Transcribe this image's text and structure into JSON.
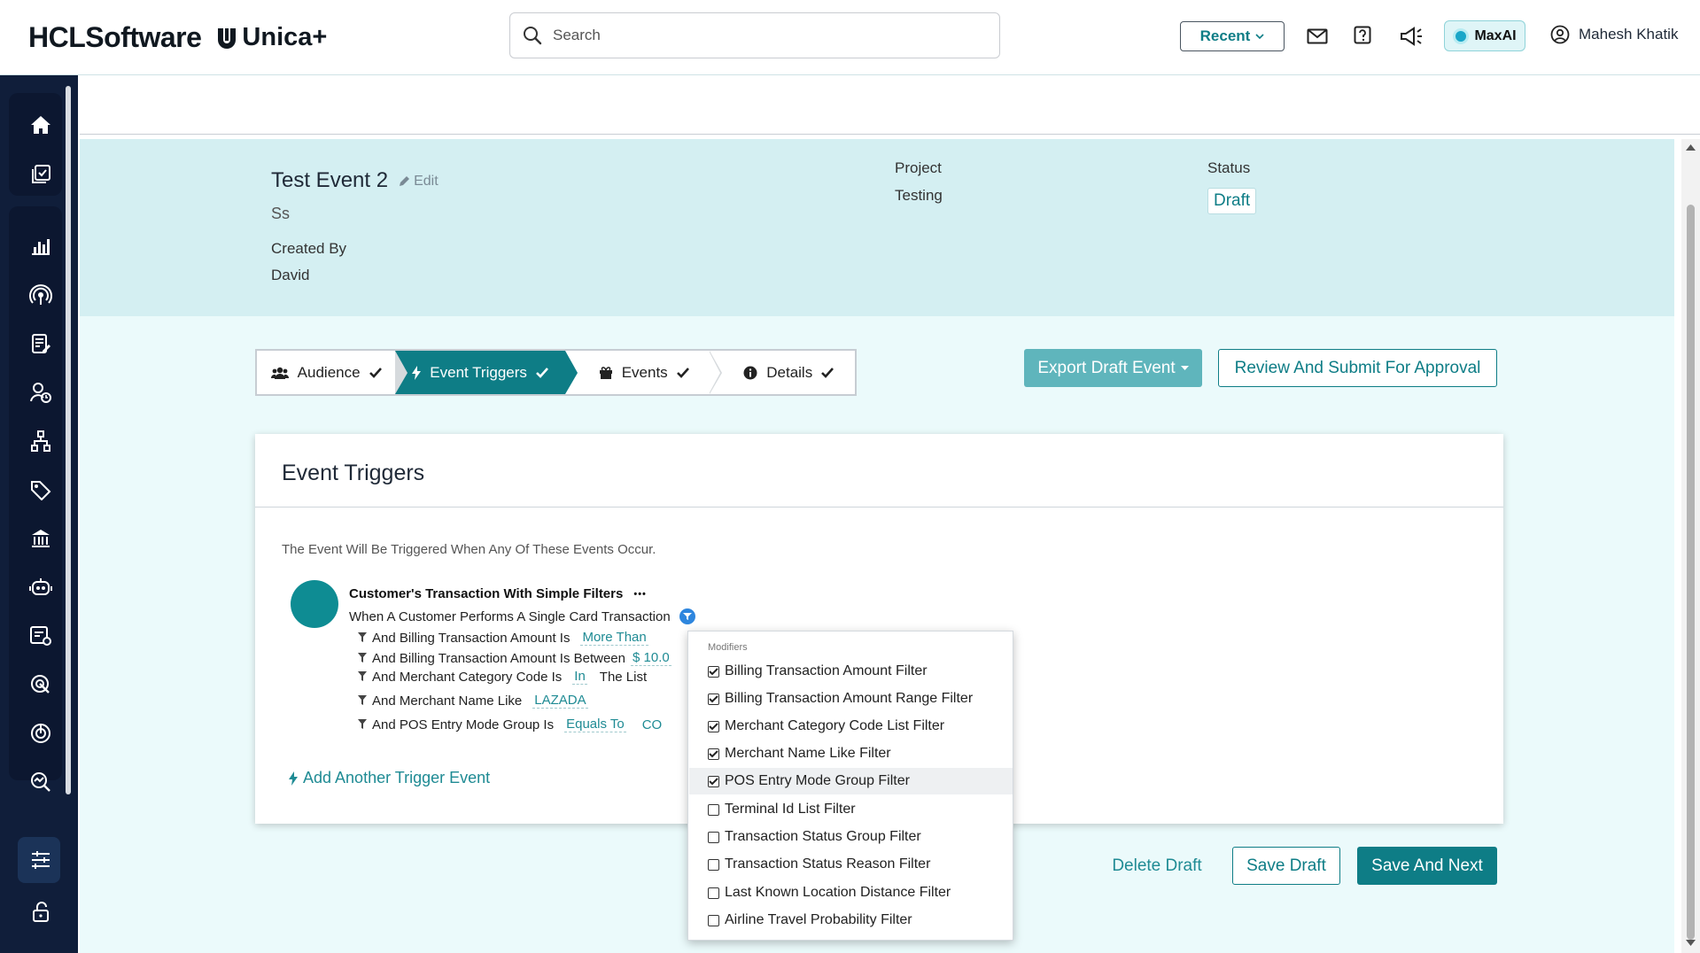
{
  "header": {
    "brand_primary": "HCLSoftware",
    "brand_product": "Unica+",
    "search_placeholder": "Search",
    "recent_label": "Recent",
    "maxai_label": "MaxAI",
    "user_name": "Mahesh Khatik",
    "icons": [
      "search-icon",
      "mail-icon",
      "help-icon",
      "megaphone-icon",
      "user-circle-icon"
    ]
  },
  "sidebar": {
    "items": [
      "home",
      "campaigns",
      "analytics",
      "broadcast",
      "forms",
      "users",
      "hierarchy",
      "tags",
      "bank",
      "bot",
      "settings-list",
      "targeting",
      "monitor",
      "insights",
      "filters",
      "unlock"
    ]
  },
  "event": {
    "title": "Test Event 2",
    "edit_label": "Edit",
    "description": "Ss",
    "created_by_label": "Created By",
    "created_by_value": "David",
    "project_label": "Project",
    "project_value": "Testing",
    "status_label": "Status",
    "status_value": "Draft"
  },
  "steps": [
    {
      "label": "Audience",
      "active": false
    },
    {
      "label": "Event Triggers",
      "active": true
    },
    {
      "label": "Events",
      "active": false
    },
    {
      "label": "Details",
      "active": false
    }
  ],
  "actions": {
    "export_label": "Export Draft Event",
    "review_label": "Review And Submit For Approval",
    "delete_label": "Delete Draft",
    "save_draft_label": "Save Draft",
    "save_next_label": "Save And Next"
  },
  "card": {
    "title": "Event Triggers",
    "intro": "The Event Will Be Triggered When Any Of These Events Occur.",
    "trigger_name": "Customer's Transaction With Simple Filters",
    "trigger_more": "•••",
    "trigger_when": "When A Customer Performs A Single Card Transaction",
    "conditions": [
      {
        "text": "And Billing Transaction Amount Is",
        "value": "More Than"
      },
      {
        "text": "And Billing Transaction Amount Is Between",
        "value": "$ 10.0"
      },
      {
        "text": "And Merchant Category Code Is",
        "value": "In",
        "extra": "The List"
      },
      {
        "text": "And Merchant Name Like",
        "value": "LAZADA"
      },
      {
        "text": "And POS Entry Mode Group Is",
        "value": "Equals To",
        "extra": "CO"
      }
    ],
    "add_trigger_label": "Add Another Trigger Event"
  },
  "modifiers": {
    "header": "Modifiers",
    "items": [
      {
        "label": "Billing Transaction Amount Filter",
        "checked": true
      },
      {
        "label": "Billing Transaction Amount Range Filter",
        "checked": true
      },
      {
        "label": "Merchant Category Code List Filter",
        "checked": true
      },
      {
        "label": "Merchant Name Like Filter",
        "checked": true
      },
      {
        "label": "POS Entry Mode Group Filter",
        "checked": true
      },
      {
        "label": "Terminal Id List Filter",
        "checked": false
      },
      {
        "label": "Transaction Status Group Filter",
        "checked": false
      },
      {
        "label": "Transaction Status Reason Filter",
        "checked": false
      },
      {
        "label": "Last Known Location Distance Filter",
        "checked": false
      },
      {
        "label": "Airline Travel Probability Filter",
        "checked": false
      }
    ]
  },
  "colors": {
    "teal": "#0e7d86",
    "header_panel": "#d4eff2",
    "main_bg": "#ebfafb",
    "sidebar": "#101e3a"
  }
}
